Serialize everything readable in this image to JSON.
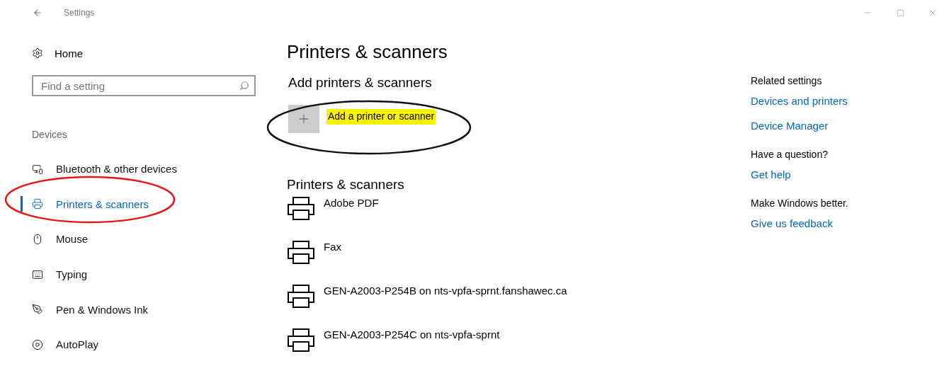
{
  "window": {
    "title": "Settings"
  },
  "sidebar": {
    "home": "Home",
    "search": {
      "placeholder": "Find a setting"
    },
    "section": "Devices",
    "items": [
      {
        "label": "Bluetooth & other devices",
        "kind": "devices",
        "selected": false
      },
      {
        "label": "Printers & scanners",
        "kind": "printer",
        "selected": true
      },
      {
        "label": "Mouse",
        "kind": "mouse",
        "selected": false
      },
      {
        "label": "Typing",
        "kind": "keyboard",
        "selected": false
      },
      {
        "label": "Pen & Windows Ink",
        "kind": "pen",
        "selected": false
      },
      {
        "label": "AutoPlay",
        "kind": "autoplay",
        "selected": false
      }
    ]
  },
  "main": {
    "title": "Printers & scanners",
    "add_section": "Add printers & scanners",
    "add_button": {
      "label": "Add a printer or scanner",
      "highlighted": true
    },
    "list_title": "Printers & scanners",
    "printers": [
      {
        "name": "Adobe PDF"
      },
      {
        "name": "Fax"
      },
      {
        "name": "GEN-A2003-P254B on nts-vpfa-sprnt.fanshawec.ca"
      },
      {
        "name": "GEN-A2003-P254C on nts-vpfa-sprnt"
      }
    ]
  },
  "related": [
    {
      "heading": "Related settings",
      "links": [
        "Devices and printers",
        "Device Manager"
      ]
    },
    {
      "heading": "Have a question?",
      "links": [
        "Get help"
      ]
    },
    {
      "heading": "Make Windows better.",
      "links": [
        "Give us feedback"
      ]
    }
  ],
  "annotations": [
    {
      "kind": "ellipse",
      "color": "#e8141c"
    },
    {
      "kind": "ellipse",
      "color": "#111111"
    }
  ]
}
